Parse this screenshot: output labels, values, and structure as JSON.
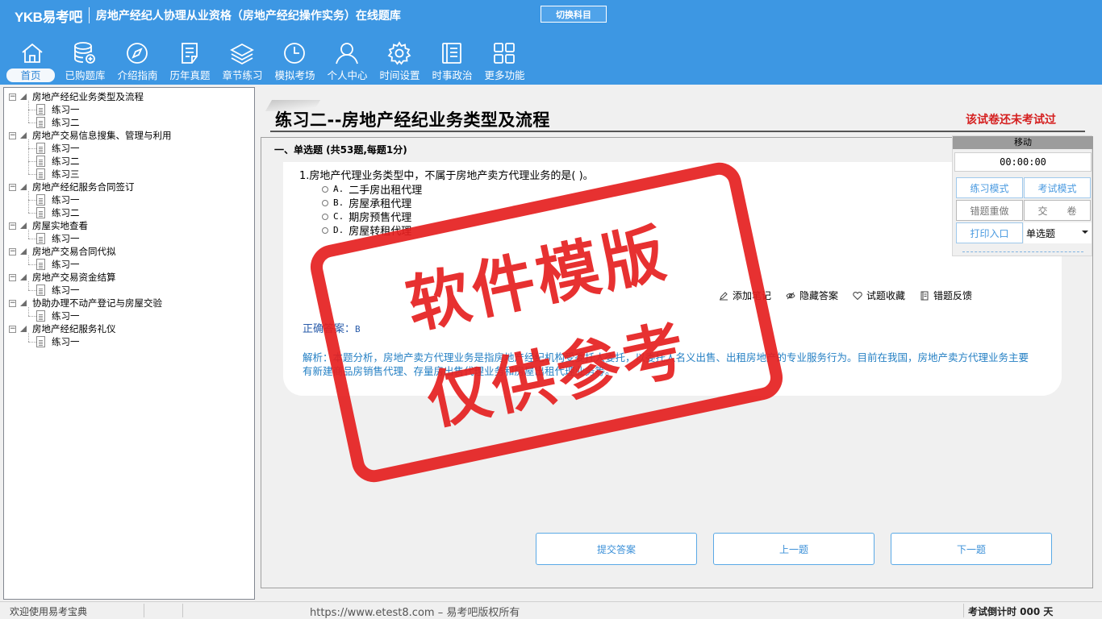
{
  "header": {
    "logo": "YKB易考吧",
    "title": "房地产经纪人协理从业资格（房地产经纪操作实务）在线题库",
    "switch_label": "切换科目",
    "nav": [
      {
        "label": "首页",
        "icon": "home-icon"
      },
      {
        "label": "已购题库",
        "icon": "database-icon"
      },
      {
        "label": "介绍指南",
        "icon": "compass-icon"
      },
      {
        "label": "历年真题",
        "icon": "checklist-icon"
      },
      {
        "label": "章节练习",
        "icon": "layers-icon"
      },
      {
        "label": "模拟考场",
        "icon": "clock-icon"
      },
      {
        "label": "个人中心",
        "icon": "user-icon"
      },
      {
        "label": "时间设置",
        "icon": "gear-icon"
      },
      {
        "label": "时事政治",
        "icon": "notebook-icon"
      },
      {
        "label": "更多功能",
        "icon": "grid-icon"
      }
    ]
  },
  "tree": {
    "chapters": [
      {
        "label": "房地产经纪业务类型及流程",
        "items": [
          "练习一",
          "练习二"
        ]
      },
      {
        "label": "房地产交易信息搜集、管理与利用",
        "items": [
          "练习一",
          "练习二",
          "练习三"
        ]
      },
      {
        "label": "房地产经纪服务合同签订",
        "items": [
          "练习一",
          "练习二"
        ]
      },
      {
        "label": "房屋实地查看",
        "items": [
          "练习一"
        ]
      },
      {
        "label": "房地产交易合同代拟",
        "items": [
          "练习一"
        ]
      },
      {
        "label": "房地产交易资金结算",
        "items": [
          "练习一"
        ]
      },
      {
        "label": "协助办理不动产登记与房屋交验",
        "items": [
          "练习一"
        ]
      },
      {
        "label": "房地产经纪服务礼仪",
        "items": [
          "练习一"
        ]
      }
    ]
  },
  "paper": {
    "title": "练习二--房地产经纪业务类型及流程",
    "status": "该试卷还未考试过",
    "section": "一、单选题 (共53题,每题1分)"
  },
  "question": {
    "text": "1.房地产代理业务类型中，不属于房地产卖方代理业务的是( )。",
    "options": [
      {
        "letter": "A.",
        "text": "二手房出租代理"
      },
      {
        "letter": "B.",
        "text": "房屋承租代理"
      },
      {
        "letter": "C.",
        "text": "期房预售代理"
      },
      {
        "letter": "D.",
        "text": "房屋转租代理"
      }
    ],
    "actions": {
      "note": "添加笔记",
      "hide": "隐藏答案",
      "favorite": "试题收藏",
      "feedback": "错题反馈"
    },
    "answer_label": "正确答案：",
    "answer_value": "B",
    "analysis": "解析：本题分析，房地产卖方代理业务是指房地产经纪机构受委托人委托，以委托人名义出售、出租房地产的专业服务行为。目前在我国，房地产卖方代理业务主要有新建商品房销售代理、存量房出售代理业务和房屋出租代理业务等。"
  },
  "buttons": {
    "submit": "提交答案",
    "prev": "上一题",
    "next": "下一题"
  },
  "float_panel": {
    "move": "移动",
    "timer": "00:00:00",
    "practice_mode": "练习模式",
    "exam_mode": "考试模式",
    "redo_wrong": "错题重做",
    "hand_in": "交　　卷",
    "print": "打印入口",
    "question_type": "单选题"
  },
  "watermark": {
    "line1": "软件模版",
    "line2": "仅供参考"
  },
  "statusbar": {
    "welcome": "欢迎使用易考宝典",
    "copyright": "https://www.etest8.com – 易考吧版权所有",
    "countdown": "考试倒计时 000 天"
  },
  "colors": {
    "header_bg": "#3d97e3",
    "status_red": "#d52020",
    "analysis_blue": "#2580c4",
    "watermark_red": "#e52020"
  }
}
